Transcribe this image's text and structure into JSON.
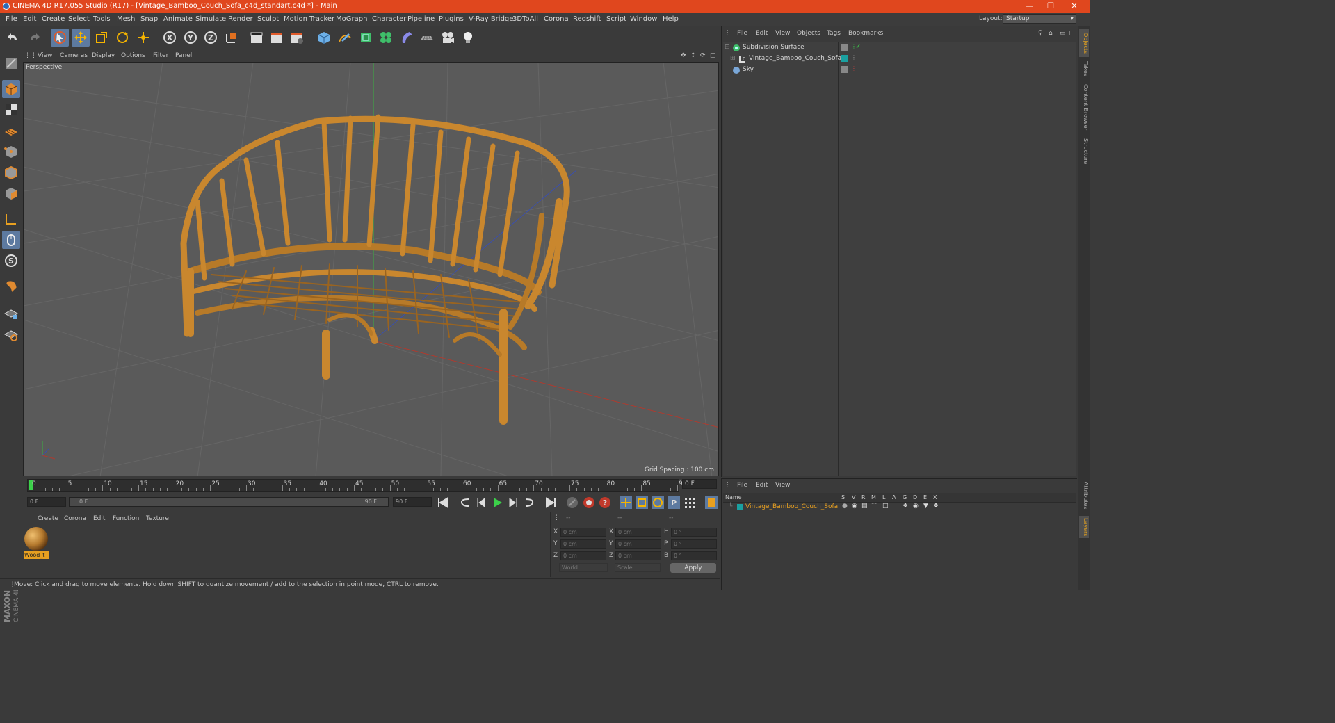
{
  "window": {
    "title": "CINEMA 4D R17.055 Studio (R17) - [Vintage_Bamboo_Couch_Sofa_c4d_standart.c4d *] - Main"
  },
  "menubar": {
    "items": [
      "File",
      "Edit",
      "Create",
      "Select",
      "Tools",
      "Mesh",
      "Snap",
      "Animate",
      "Simulate",
      "Render",
      "Sculpt",
      "Motion Tracker",
      "MoGraph",
      "Character",
      "Pipeline",
      "Plugins",
      "V-Ray Bridge",
      "3DToAll",
      "Corona",
      "Redshift",
      "Script",
      "Window",
      "Help"
    ],
    "layout_label": "Layout:",
    "layout_value": "Startup"
  },
  "viewport": {
    "menu": [
      "View",
      "Cameras",
      "Display",
      "Options",
      "Filter",
      "Panel"
    ],
    "label": "Perspective",
    "grid_spacing": "Grid Spacing : 100 cm"
  },
  "timeline": {
    "ticks": [
      "0",
      "5",
      "10",
      "15",
      "20",
      "25",
      "30",
      "35",
      "40",
      "45",
      "50",
      "55",
      "60",
      "65",
      "70",
      "75",
      "80",
      "85",
      "90"
    ],
    "end_field": "0 F",
    "start_field": "0 F",
    "range_start": "0 F",
    "range_end": "90 F",
    "max_field": "90 F"
  },
  "material": {
    "menu": [
      "Create",
      "Corona",
      "Edit",
      "Function",
      "Texture"
    ],
    "items": [
      {
        "name": "Wood_t"
      }
    ]
  },
  "coords": {
    "header": [
      "--",
      "--",
      "--"
    ],
    "rows": [
      {
        "a": "X",
        "av": "0 cm",
        "b": "X",
        "bv": "0 cm",
        "c": "H",
        "cv": "0 °"
      },
      {
        "a": "Y",
        "av": "0 cm",
        "b": "Y",
        "bv": "0 cm",
        "c": "P",
        "cv": "0 °"
      },
      {
        "a": "Z",
        "av": "0 cm",
        "b": "Z",
        "bv": "0 cm",
        "c": "B",
        "cv": "0 °"
      }
    ],
    "world": "World",
    "scale": "Scale",
    "apply": "Apply"
  },
  "status": {
    "text": "Move: Click and drag to move elements. Hold down SHIFT to quantize movement / add to the selection in point mode, CTRL to remove."
  },
  "object_manager": {
    "menu": [
      "File",
      "Edit",
      "View",
      "Objects",
      "Tags",
      "Bookmarks"
    ],
    "objects": [
      {
        "name": "Subdivision Surface"
      },
      {
        "name": "Vintage_Bamboo_Couch_Sofa"
      },
      {
        "name": "Sky"
      }
    ]
  },
  "layer_manager": {
    "menu": [
      "File",
      "Edit",
      "View"
    ],
    "columns": [
      "Name",
      "S",
      "V",
      "R",
      "M",
      "L",
      "A",
      "G",
      "D",
      "E",
      "X"
    ],
    "layers": [
      {
        "name": "Vintage_Bamboo_Couch_Sofa"
      }
    ]
  },
  "side_tabs": [
    "Objects",
    "Takes",
    "Content Browser",
    "Structure",
    "Attributes",
    "Layers"
  ],
  "branding": {
    "maxon": "MAXON",
    "c4d": "CINEMA 4D"
  },
  "colors": {
    "accent": "#e0471e",
    "selected": "#5d7aa0",
    "bamboo": "#c9872e",
    "layer_teal": "#1aa0a0"
  }
}
